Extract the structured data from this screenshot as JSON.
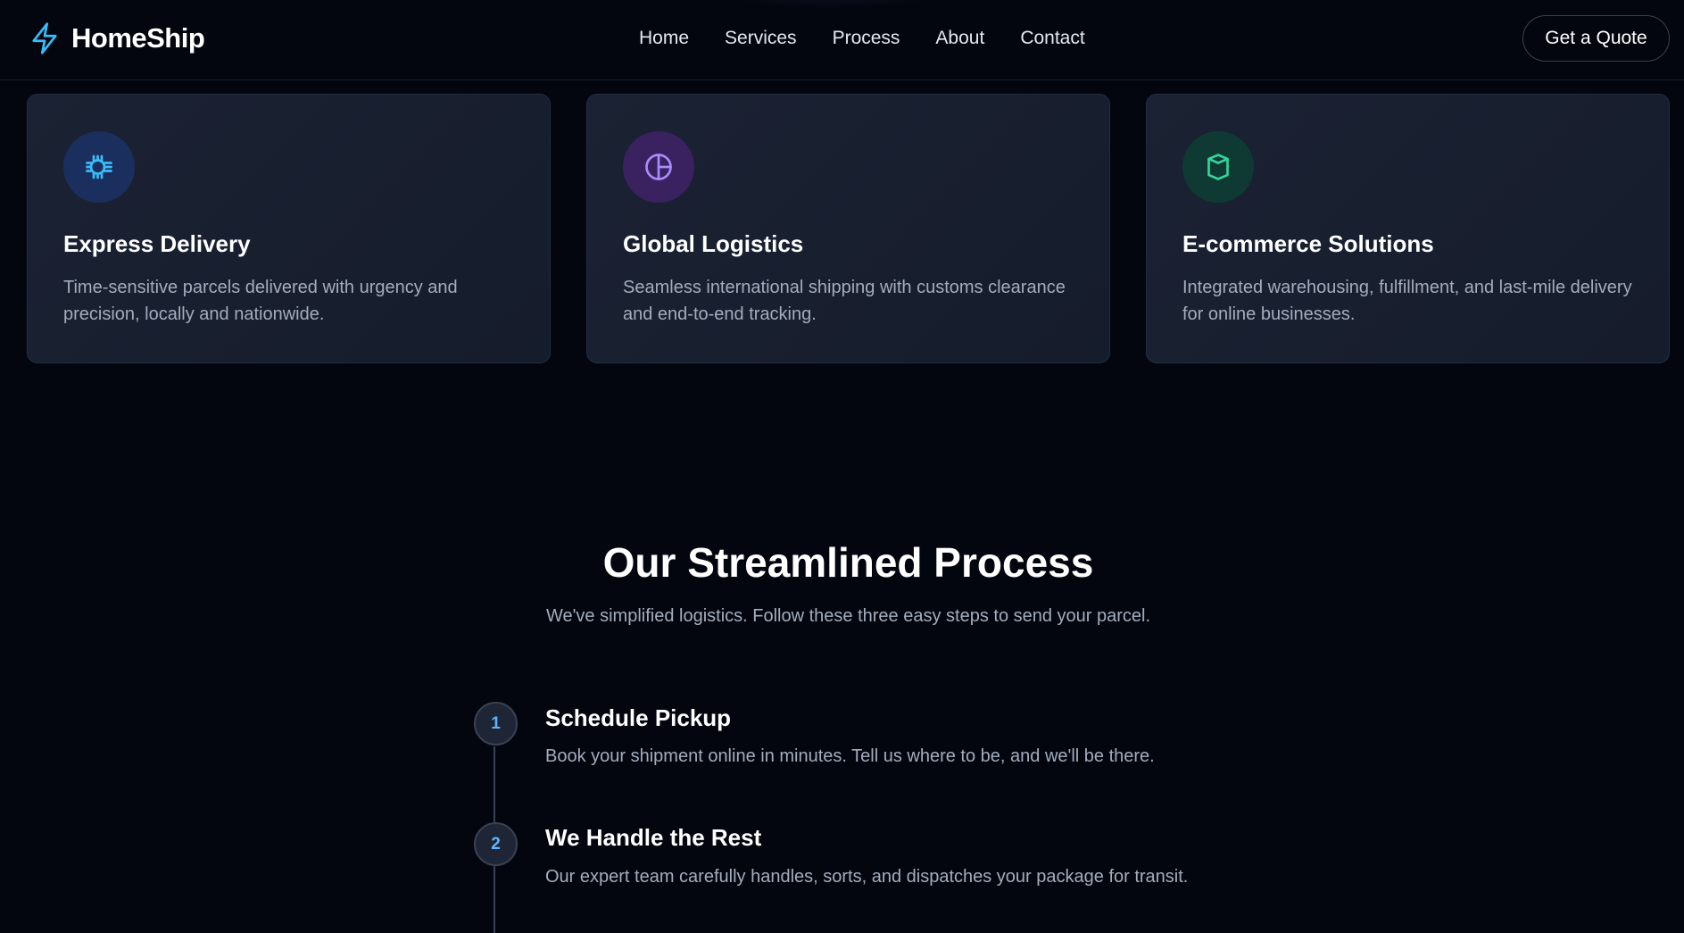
{
  "nav": {
    "brand": "HomeShip",
    "links": [
      "Home",
      "Services",
      "Process",
      "About",
      "Contact"
    ],
    "cta": "Get a Quote"
  },
  "services": [
    {
      "icon": "chip-icon",
      "title": "Express Delivery",
      "description": "Time-sensitive parcels delivered with urgency and precision, locally and nationwide."
    },
    {
      "icon": "pie-chart-icon",
      "title": "Global Logistics",
      "description": "Seamless international shipping with customs clearance and end-to-end tracking."
    },
    {
      "icon": "box-icon",
      "title": "E-commerce Solutions",
      "description": "Integrated warehousing, fulfillment, and last-mile delivery for online businesses."
    }
  ],
  "process": {
    "title": "Our Streamlined Process",
    "subtitle": "We've simplified logistics. Follow these three easy steps to send your parcel.",
    "steps": [
      {
        "number": "1",
        "title": "Schedule Pickup",
        "description": "Book your shipment online in minutes. Tell us where to be, and we'll be there."
      },
      {
        "number": "2",
        "title": "We Handle the Rest",
        "description": "Our expert team carefully handles, sorts, and dispatches your package for transit."
      }
    ]
  },
  "colors": {
    "background": "#03060f",
    "card": "#1b2233",
    "accent_blue": "#38bdf8",
    "accent_purple": "#a78bfa",
    "accent_green": "#34d399",
    "muted_text": "#a3adbd"
  }
}
